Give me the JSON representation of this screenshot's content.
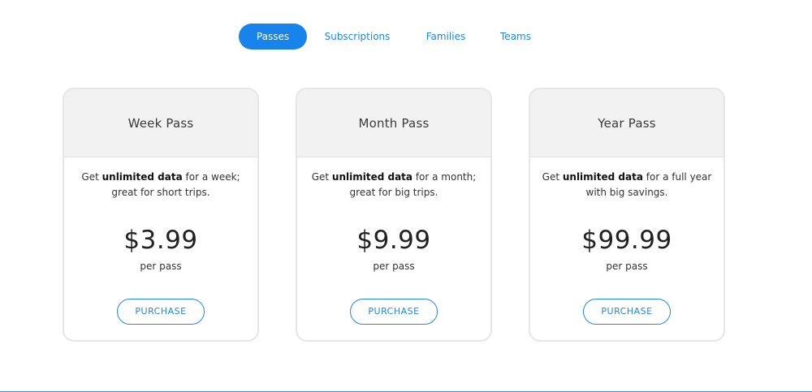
{
  "tabs": [
    {
      "label": "Passes",
      "active": true
    },
    {
      "label": "Subscriptions",
      "active": false
    },
    {
      "label": "Families",
      "active": false
    },
    {
      "label": "Teams",
      "active": false
    }
  ],
  "cards": [
    {
      "title": "Week Pass",
      "desc_prefix": "Get ",
      "desc_bold": "unlimited data",
      "desc_suffix": " for a week; great for short trips.",
      "price": "$3.99",
      "unit": "per pass",
      "button": "PURCHASE"
    },
    {
      "title": "Month Pass",
      "desc_prefix": "Get ",
      "desc_bold": "unlimited data",
      "desc_suffix": " for a month; great for big trips.",
      "price": "$9.99",
      "unit": "per pass",
      "button": "PURCHASE"
    },
    {
      "title": "Year Pass",
      "desc_prefix": "Get ",
      "desc_bold": "unlimited data",
      "desc_suffix": " for a full year with big savings.",
      "price": "$99.99",
      "unit": "per pass",
      "button": "PURCHASE"
    }
  ],
  "colors": {
    "accent": "#1883ea",
    "link": "#1f87e5",
    "card_header_bg": "#f2f2f2",
    "card_border": "#e6e6e6"
  }
}
